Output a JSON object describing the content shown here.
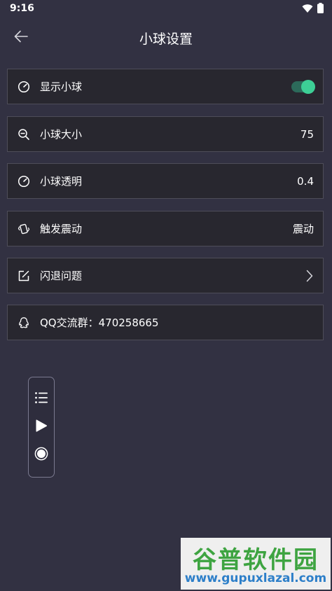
{
  "status_bar": {
    "time": "9:16",
    "icons": [
      "wifi-icon",
      "battery-icon"
    ]
  },
  "app_bar": {
    "title": "小球设置",
    "back_icon": "arrow-left-icon"
  },
  "settings": {
    "show_ball": {
      "label": "显示小球",
      "icon": "gauge-icon",
      "enabled": true
    },
    "ball_size": {
      "label": "小球大小",
      "icon": "zoom-icon",
      "value": "75"
    },
    "ball_opacity": {
      "label": "小球透明",
      "icon": "gauge-icon",
      "value": "0.4"
    },
    "vibration": {
      "label": "触发震动",
      "icon": "vibrate-icon",
      "value": "震动"
    },
    "crash": {
      "label": "闪退问题",
      "icon": "edit-icon",
      "chevron": "chevron-right-icon"
    },
    "qq_group": {
      "label": "QQ交流群：470258665",
      "icon": "qq-icon"
    }
  },
  "float_panel": {
    "buttons": [
      "list-icon",
      "play-icon",
      "record-icon"
    ]
  },
  "watermark": {
    "brand": "谷普软件园",
    "url": "www.gupuxlazal.com"
  },
  "colors": {
    "background": "#323142",
    "row_background": "#28272f",
    "row_border": "#4e4d59",
    "toggle_on": "#3dcf96"
  }
}
